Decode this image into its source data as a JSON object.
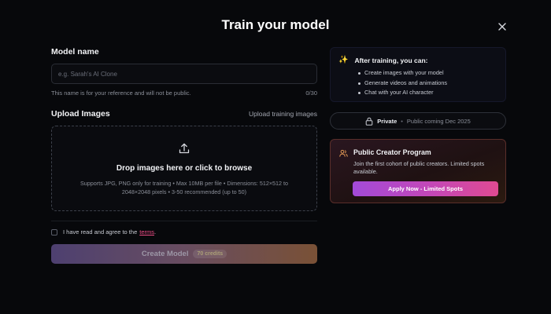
{
  "header": {
    "title": "Train your model",
    "close_icon": "close-icon"
  },
  "form": {
    "model_name_label": "Model name",
    "model_name_placeholder": "e.g. Sarah's AI Clone",
    "model_name_value": "",
    "model_name_hint": "This name is for your reference and will not be public.",
    "char_count": "0/30",
    "upload_label": "Upload Images",
    "upload_link": "Upload training images",
    "dropzone": {
      "icon": "upload-icon",
      "title": "Drop images here or click to browse",
      "description": "Supports JPG, PNG only for training • Max 10MB per file • Dimensions: 512×512 to 2048×2048 pixels • 3-50 recommended (up to 50)"
    },
    "terms_prefix": "I have read and agree to the",
    "terms_link": "terms",
    "terms_suffix": ".",
    "terms_checked": false,
    "create_button": "Create Model",
    "credits": "70 credits"
  },
  "after_training": {
    "icon": "sparkle-icon",
    "title": "After training, you can:",
    "items": [
      "Create images with your model",
      "Generate videos and animations",
      "Chat with your AI character"
    ]
  },
  "privacy": {
    "icon": "lock-icon",
    "label": "Private",
    "separator": "•",
    "coming": "Public coming Dec 2025"
  },
  "creator_program": {
    "icon": "people-icon",
    "title": "Public Creator Program",
    "description": "Join the first cohort of public creators. Limited spots available.",
    "button": "Apply Now - Limited Spots"
  },
  "colors": {
    "background": "#07080b",
    "accent_pink": "#ef4b86",
    "apply_gradient_start": "#a34ad8",
    "apply_gradient_end": "#e04a92",
    "sparkle": "#f5c84b"
  }
}
